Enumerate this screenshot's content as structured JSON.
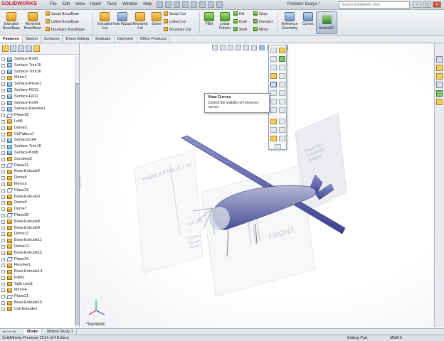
{
  "app": {
    "logo": "SOLIDWORKS",
    "document_title": "Predator Body1 *",
    "search_placeholder": "Search SolidWorks Help"
  },
  "menu": [
    "File",
    "Edit",
    "View",
    "Insert",
    "Tools",
    "Window",
    "Help"
  ],
  "ribbon": {
    "big": [
      {
        "label": "Extruded Boss/Base"
      },
      {
        "label": "Revolved Boss/Base"
      },
      {
        "label": "Extruded Cut"
      },
      {
        "label": "Hole Wizard"
      },
      {
        "label": "Revolved Cut"
      },
      {
        "label": "Dome"
      },
      {
        "label": "Fillet"
      },
      {
        "label": "Linear Pattern"
      },
      {
        "label": "Reference Geometry"
      },
      {
        "label": "Curves"
      }
    ],
    "small_boss": [
      "Swept Boss/Base",
      "Lofted Boss/Base",
      "Boundary Boss/Base"
    ],
    "small_cut": [
      "Swept Cut",
      "Lofted Cut",
      "Boundary Cut"
    ],
    "small_features": [
      "Rib",
      "Draft",
      "Shell"
    ],
    "small_features2": [
      "Wrap",
      "Intersect",
      "Mirror"
    ],
    "instant3d": "Instant3D"
  },
  "command_tabs": [
    "Features",
    "Sketch",
    "Surfaces",
    "Direct Editing",
    "Evaluate",
    "DimXpert",
    "Office Products"
  ],
  "feature_tree": [
    {
      "label": "Surface-Knit3",
      "type": "surface"
    },
    {
      "label": "Surface-Trim15",
      "type": "surface"
    },
    {
      "label": "Surface-Trim16",
      "type": "surface"
    },
    {
      "label": "Mirror1",
      "type": "feature"
    },
    {
      "label": "Surface-Plane1",
      "type": "surface"
    },
    {
      "label": "Surface-Fill11",
      "type": "surface"
    },
    {
      "label": "Surface-Fill12",
      "type": "surface"
    },
    {
      "label": "Surface-Knit4",
      "type": "surface"
    },
    {
      "label": "Surface-Revolve1",
      "type": "surface"
    },
    {
      "label": "Plane18",
      "type": "plane"
    },
    {
      "label": "Loft1",
      "type": "feature"
    },
    {
      "label": "Dome3",
      "type": "feature"
    },
    {
      "label": "CirPattern1",
      "type": "feature"
    },
    {
      "label": "SurfaceCut4",
      "type": "surface"
    },
    {
      "label": "Surface-Trim18",
      "type": "surface"
    },
    {
      "label": "Surface-Knit8",
      "type": "surface"
    },
    {
      "label": "Combine2",
      "type": "feature"
    },
    {
      "label": "Plane21",
      "type": "plane"
    },
    {
      "label": "Boss-Extrude2",
      "type": "feature"
    },
    {
      "label": "Dome5",
      "type": "feature"
    },
    {
      "label": "Mirror3",
      "type": "feature"
    },
    {
      "label": "Plane23",
      "type": "plane"
    },
    {
      "label": "Boss-Extrude3",
      "type": "feature"
    },
    {
      "label": "Dome6",
      "type": "feature"
    },
    {
      "label": "Dome7",
      "type": "feature"
    },
    {
      "label": "Plane28",
      "type": "plane"
    },
    {
      "label": "Boss-Extrude8",
      "type": "feature"
    },
    {
      "label": "Boss-Extrude9",
      "type": "feature"
    },
    {
      "label": "Dome11",
      "type": "feature"
    },
    {
      "label": "Boss-Extrude11",
      "type": "feature"
    },
    {
      "label": "Dome12",
      "type": "feature"
    },
    {
      "label": "Boss-Extrude12",
      "type": "feature"
    },
    {
      "label": "Plane29",
      "type": "plane"
    },
    {
      "label": "Revolve1",
      "type": "feature"
    },
    {
      "label": "Boss-Extrude14",
      "type": "feature"
    },
    {
      "label": "Fillet1",
      "type": "feature"
    },
    {
      "label": "Split Line8",
      "type": "feature"
    },
    {
      "label": "Mirror4",
      "type": "feature"
    },
    {
      "label": "Plane31",
      "type": "plane"
    },
    {
      "label": "Boss-Extrude15",
      "type": "feature"
    },
    {
      "label": "Cut-Extrude1",
      "type": "feature"
    }
  ],
  "tooltip": {
    "title": "View Curves",
    "description": "Control the visibility of reference curves."
  },
  "model": {
    "dimension_text": "Height: 6.9 feet",
    "dimension_sub": "(2.1 m)",
    "engine_label": "Rotax 914",
    "engine_label2": "4-Cylinder",
    "engine_label3": "Engine",
    "front_label": "FRONT",
    "sar_label": "SAR Link",
    "camera_label": "Camera",
    "sensor_label": "Sensor",
    "array_label": "Array"
  },
  "view_orientation": "*Isometric",
  "bottom_tabs": [
    "Model",
    "Motion Study 1"
  ],
  "status": {
    "edition": "SolidWorks Premium 2014 x64 Edition",
    "mode": "Editing Part",
    "units": "MMGS"
  },
  "colors": {
    "logo_red": "#c8102e",
    "wing_body": "#5a5fa8"
  }
}
